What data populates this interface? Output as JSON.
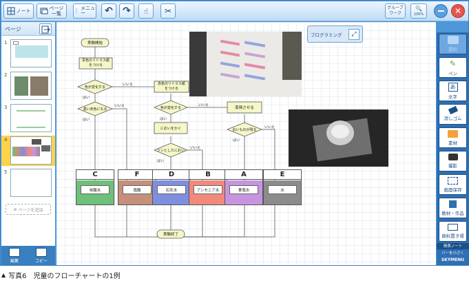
{
  "toolbar": {
    "note": "ノート",
    "page_list": "ページ\n一覧",
    "menu": "メニュー",
    "group_work": "グループ\nワーク",
    "zoom": "100%"
  },
  "sidebar": {
    "header": "ページ",
    "pages": [
      {
        "num": "1"
      },
      {
        "num": "2"
      },
      {
        "num": "3"
      },
      {
        "num": "4",
        "selected": true
      },
      {
        "num": "5"
      }
    ],
    "add_page": "ページを追加",
    "footer_buttons": [
      "編集",
      "コピー"
    ]
  },
  "right_panel": {
    "items": [
      {
        "label": "選択",
        "icon": "select-icon"
      },
      {
        "label": "ペン",
        "icon": "pen-icon"
      },
      {
        "label": "文字",
        "icon": "text-icon"
      },
      {
        "label": "消しゴム",
        "icon": "eraser-icon"
      },
      {
        "label": "素材",
        "icon": "folder-icon"
      },
      {
        "label": "撮影",
        "icon": "camera-icon"
      },
      {
        "label": "画面保存",
        "icon": "screen-save-icon"
      },
      {
        "label": "教材・作品",
        "icon": "materials-icon"
      },
      {
        "label": "資料置き場",
        "icon": "storage-icon"
      }
    ],
    "note_label": "発表ノート",
    "shrink_bar": "バーを小さく",
    "brand": "SKYMENU"
  },
  "programming_button": "プログラミング",
  "flowchart": {
    "start": "実験開始",
    "step1": "青色のリトマス紙\nをつける",
    "step2": "赤色のリトマス紙\nをつける",
    "decision1": "色が変化する",
    "decision1_no": "いいえ",
    "decision1_yes": "はい",
    "decision2": "濃い赤色になる",
    "decision2_yes": "はい",
    "decision2_no": "いいえ",
    "decision3": "色が変化する",
    "decision3_yes": "はい",
    "decision3_no": "いいえ",
    "evaporate": "蒸発させる",
    "decision4": "白いものが残る",
    "decision4_yes": "はい",
    "decision4_no": "いいえ",
    "smell": "においをかぐ",
    "decision5": "ツンとしたにおい",
    "decision5_yes": "はい",
    "decision5_no": "いいえ",
    "end": "実験終了"
  },
  "cards": [
    {
      "letter": "C",
      "label": "炭酸水",
      "color": "#6ec07a"
    },
    {
      "letter": "F",
      "label": "塩酸",
      "color": "#c58f7a"
    },
    {
      "letter": "D",
      "label": "石灰水",
      "color": "#7e8fe0"
    },
    {
      "letter": "B",
      "label": "アンモニア水",
      "color": "#f18a7a"
    },
    {
      "letter": "A",
      "label": "食塩水",
      "color": "#c795df"
    },
    {
      "letter": "E",
      "label": "水",
      "color": "#8c8c8c"
    }
  ],
  "caption": "写真6　児童のフローチャートの1例"
}
